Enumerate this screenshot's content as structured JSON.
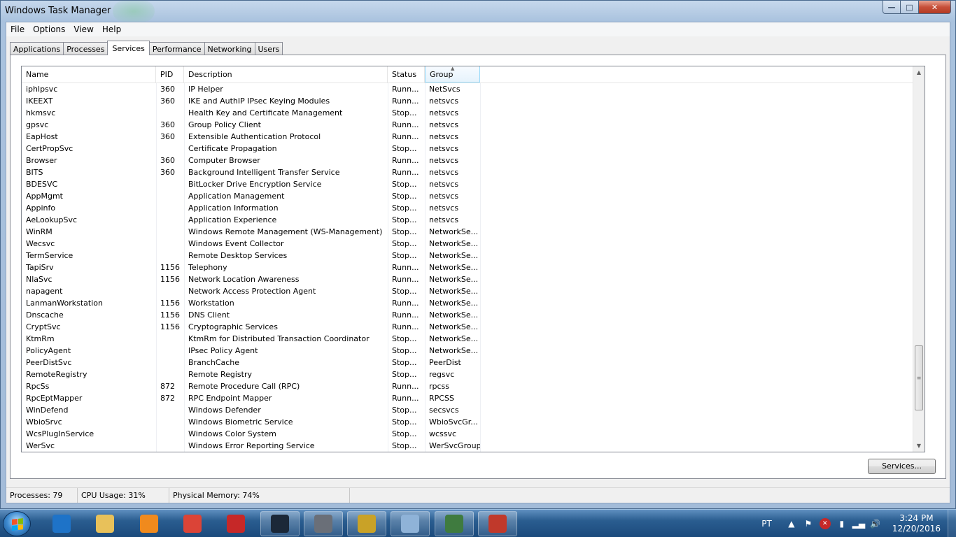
{
  "window": {
    "title": "Windows Task Manager"
  },
  "menu": [
    "File",
    "Options",
    "View",
    "Help"
  ],
  "tabs": [
    "Applications",
    "Processes",
    "Services",
    "Performance",
    "Networking",
    "Users"
  ],
  "active_tab": "Services",
  "columns": {
    "name": "Name",
    "pid": "PID",
    "description": "Description",
    "status": "Status",
    "group": "Group"
  },
  "sort_column": "group",
  "rows": [
    {
      "name": "iphlpsvc",
      "pid": "360",
      "description": "IP Helper",
      "status": "Runn...",
      "group": "NetSvcs"
    },
    {
      "name": "IKEEXT",
      "pid": "360",
      "description": "IKE and AuthIP IPsec Keying Modules",
      "status": "Runn...",
      "group": "netsvcs"
    },
    {
      "name": "hkmsvc",
      "pid": "",
      "description": "Health Key and Certificate Management",
      "status": "Stop...",
      "group": "netsvcs"
    },
    {
      "name": "gpsvc",
      "pid": "360",
      "description": "Group Policy Client",
      "status": "Runn...",
      "group": "netsvcs"
    },
    {
      "name": "EapHost",
      "pid": "360",
      "description": "Extensible Authentication Protocol",
      "status": "Runn...",
      "group": "netsvcs"
    },
    {
      "name": "CertPropSvc",
      "pid": "",
      "description": "Certificate Propagation",
      "status": "Stop...",
      "group": "netsvcs"
    },
    {
      "name": "Browser",
      "pid": "360",
      "description": "Computer Browser",
      "status": "Runn...",
      "group": "netsvcs"
    },
    {
      "name": "BITS",
      "pid": "360",
      "description": "Background Intelligent Transfer Service",
      "status": "Runn...",
      "group": "netsvcs"
    },
    {
      "name": "BDESVC",
      "pid": "",
      "description": "BitLocker Drive Encryption Service",
      "status": "Stop...",
      "group": "netsvcs"
    },
    {
      "name": "AppMgmt",
      "pid": "",
      "description": "Application Management",
      "status": "Stop...",
      "group": "netsvcs"
    },
    {
      "name": "Appinfo",
      "pid": "",
      "description": "Application Information",
      "status": "Stop...",
      "group": "netsvcs"
    },
    {
      "name": "AeLookupSvc",
      "pid": "",
      "description": "Application Experience",
      "status": "Stop...",
      "group": "netsvcs"
    },
    {
      "name": "WinRM",
      "pid": "",
      "description": "Windows Remote Management (WS-Management)",
      "status": "Stop...",
      "group": "NetworkSe..."
    },
    {
      "name": "Wecsvc",
      "pid": "",
      "description": "Windows Event Collector",
      "status": "Stop...",
      "group": "NetworkSe..."
    },
    {
      "name": "TermService",
      "pid": "",
      "description": "Remote Desktop Services",
      "status": "Stop...",
      "group": "NetworkSe..."
    },
    {
      "name": "TapiSrv",
      "pid": "1156",
      "description": "Telephony",
      "status": "Runn...",
      "group": "NetworkSe..."
    },
    {
      "name": "NlaSvc",
      "pid": "1156",
      "description": "Network Location Awareness",
      "status": "Runn...",
      "group": "NetworkSe..."
    },
    {
      "name": "napagent",
      "pid": "",
      "description": "Network Access Protection Agent",
      "status": "Stop...",
      "group": "NetworkSe..."
    },
    {
      "name": "LanmanWorkstation",
      "pid": "1156",
      "description": "Workstation",
      "status": "Runn...",
      "group": "NetworkSe..."
    },
    {
      "name": "Dnscache",
      "pid": "1156",
      "description": "DNS Client",
      "status": "Runn...",
      "group": "NetworkSe..."
    },
    {
      "name": "CryptSvc",
      "pid": "1156",
      "description": "Cryptographic Services",
      "status": "Runn...",
      "group": "NetworkSe..."
    },
    {
      "name": "KtmRm",
      "pid": "",
      "description": "KtmRm for Distributed Transaction Coordinator",
      "status": "Stop...",
      "group": "NetworkSe..."
    },
    {
      "name": "PolicyAgent",
      "pid": "",
      "description": "IPsec Policy Agent",
      "status": "Stop...",
      "group": "NetworkSe..."
    },
    {
      "name": "PeerDistSvc",
      "pid": "",
      "description": "BranchCache",
      "status": "Stop...",
      "group": "PeerDist"
    },
    {
      "name": "RemoteRegistry",
      "pid": "",
      "description": "Remote Registry",
      "status": "Stop...",
      "group": "regsvc"
    },
    {
      "name": "RpcSs",
      "pid": "872",
      "description": "Remote Procedure Call (RPC)",
      "status": "Runn...",
      "group": "rpcss"
    },
    {
      "name": "RpcEptMapper",
      "pid": "872",
      "description": "RPC Endpoint Mapper",
      "status": "Runn...",
      "group": "RPCSS"
    },
    {
      "name": "WinDefend",
      "pid": "",
      "description": "Windows Defender",
      "status": "Stop...",
      "group": "secsvcs"
    },
    {
      "name": "WbioSrvc",
      "pid": "",
      "description": "Windows Biometric Service",
      "status": "Stop...",
      "group": "WbioSvcGr..."
    },
    {
      "name": "WcsPlugInService",
      "pid": "",
      "description": "Windows Color System",
      "status": "Stop...",
      "group": "wcssvc"
    },
    {
      "name": "WerSvc",
      "pid": "",
      "description": "Windows Error Reporting Service",
      "status": "Stop...",
      "group": "WerSvcGroup"
    }
  ],
  "scroll_position": 0.9,
  "services_button": "Services...",
  "status": {
    "processes": "Processes: 79",
    "cpu": "CPU Usage: 31%",
    "memory": "Physical Memory: 74%"
  },
  "taskbar": {
    "apps": [
      {
        "icon": "internet-explorer-icon",
        "color": "#1e73c8",
        "open": false
      },
      {
        "icon": "file-explorer-icon",
        "color": "#e8c15a",
        "open": false
      },
      {
        "icon": "media-player-icon",
        "color": "#f08a1d",
        "open": false
      },
      {
        "icon": "chrome-icon",
        "color": "#db4437",
        "open": false
      },
      {
        "icon": "network-globe-icon",
        "color": "#c62828",
        "open": false
      },
      {
        "icon": "steam-icon",
        "color": "#1b2838",
        "open": true
      },
      {
        "icon": "game-character-icon",
        "color": "#6a6f78",
        "open": true
      },
      {
        "icon": "game-emblem-icon",
        "color": "#c9a227",
        "open": true
      },
      {
        "icon": "disk-utility-icon",
        "color": "#8fb3d8",
        "open": true
      },
      {
        "icon": "task-manager-icon",
        "color": "#3f7b3f",
        "open": true
      },
      {
        "icon": "toolbox-icon",
        "color": "#c0392b",
        "open": true
      }
    ],
    "language": "PT",
    "time": "3:24 PM",
    "date": "12/20/2016"
  },
  "colors": {
    "taskbar": "#2a5d90",
    "titlebar": "#c6d8ec",
    "close_button": "#c7503a",
    "sorted_header": "#e6f3fc"
  }
}
